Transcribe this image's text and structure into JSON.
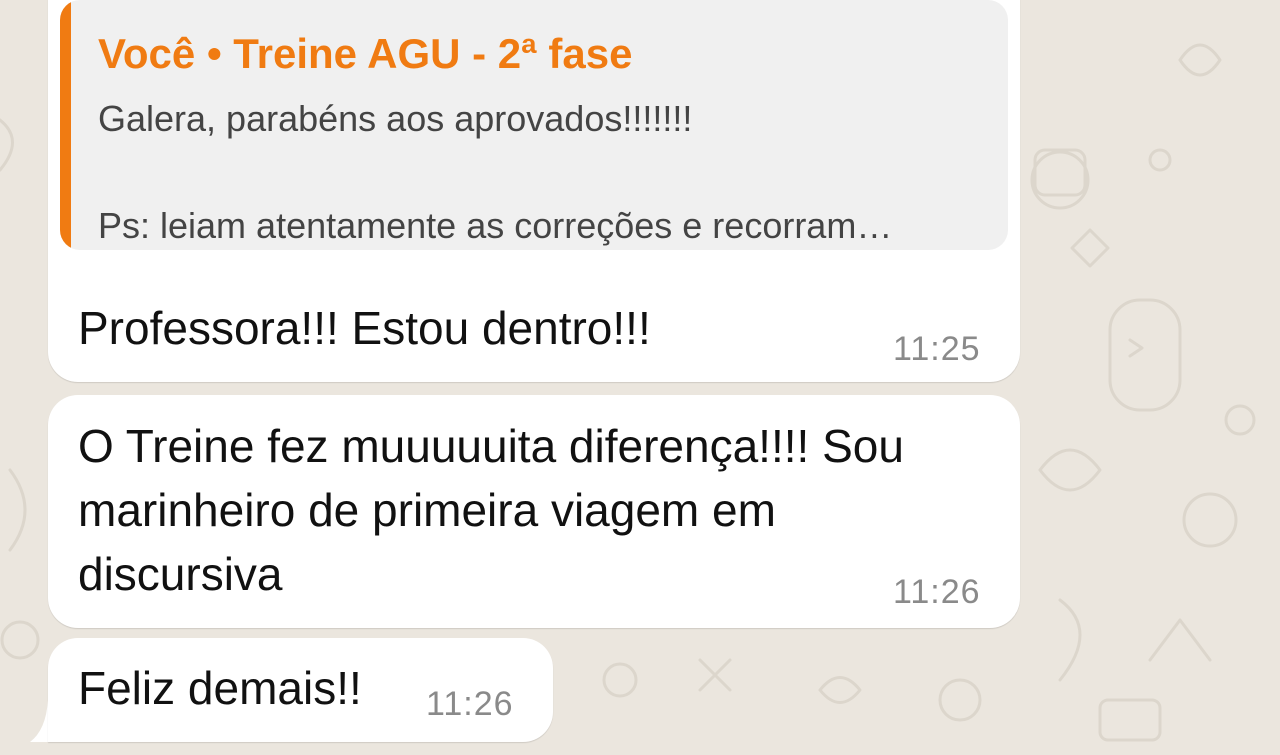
{
  "quoted_message": {
    "author": "Você • Treine AGU - 2ª fase",
    "line1": "Galera, parabéns aos aprovados!!!!!!!",
    "line2": "Ps: leiam atentamente as correções e recorram…"
  },
  "messages": [
    {
      "lines": [
        "Professora!!! Estou dentro!!!"
      ],
      "time": "11:25"
    },
    {
      "lines": [
        "O Treine fez muuuuuita diferença!!!! Sou",
        "marinheiro de primeira viagem em",
        "discursiva"
      ],
      "time": "11:26"
    },
    {
      "lines": [
        "Feliz demais!!"
      ],
      "time": "11:26"
    }
  ],
  "colors": {
    "accent": "#f07b12",
    "bubble": "#ffffff",
    "background": "#ebe6de",
    "quote_background": "#f0f0f0"
  }
}
